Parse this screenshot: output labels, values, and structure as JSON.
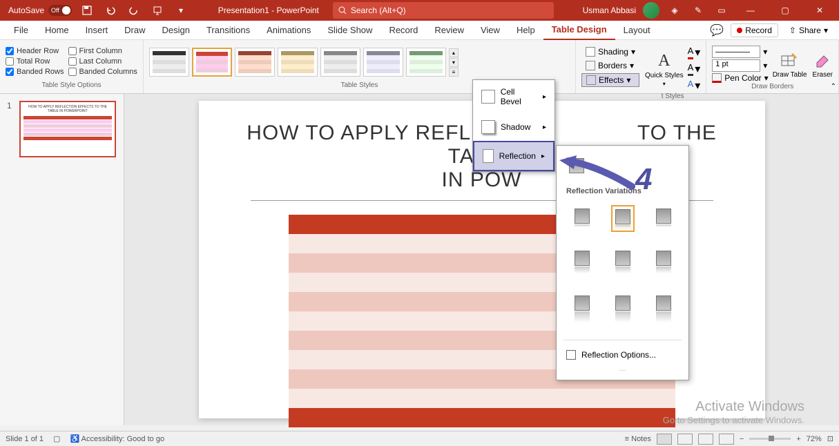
{
  "titlebar": {
    "autosave_label": "AutoSave",
    "autosave_state": "Off",
    "doc_title": "Presentation1 - PowerPoint",
    "search_placeholder": "Search (Alt+Q)",
    "user_name": "Usman Abbasi"
  },
  "tabs": {
    "file": "File",
    "home": "Home",
    "insert": "Insert",
    "draw": "Draw",
    "design": "Design",
    "transitions": "Transitions",
    "animations": "Animations",
    "slideshow": "Slide Show",
    "record": "Record",
    "review": "Review",
    "view": "View",
    "help": "Help",
    "table_design": "Table Design",
    "layout": "Layout",
    "record_btn": "Record",
    "share_btn": "Share"
  },
  "ribbon": {
    "style_options": {
      "header_row": "Header Row",
      "total_row": "Total Row",
      "banded_rows": "Banded Rows",
      "first_column": "First Column",
      "last_column": "Last Column",
      "banded_columns": "Banded Columns",
      "group_label": "Table Style Options"
    },
    "table_styles_label": "Table Styles",
    "shading": "Shading",
    "borders": "Borders",
    "effects": "Effects",
    "quick_styles": "Quick Styles",
    "wordart_label": "t Styles",
    "pen_weight": "1 pt",
    "pen_color": "Pen Color",
    "draw_table": "Draw Table",
    "eraser": "Eraser",
    "draw_borders_label": "Draw Borders"
  },
  "effects_menu": {
    "cell_bevel": "Cell Bevel",
    "shadow": "Shadow",
    "reflection": "Reflection"
  },
  "reflection_panel": {
    "variations_label": "Reflection Variations",
    "options_label": "Reflection Options..."
  },
  "annotation": {
    "number": "4"
  },
  "slide": {
    "title_line1": "HOW TO APPLY REFLECTION",
    "title_line2": "TO THE TABLE",
    "title_line3": "IN POW",
    "full_title": "HOW TO APPLY REFLECTION EFFECTS TO THE TABLE IN POWERPOINT"
  },
  "activate": {
    "title": "Activate Windows",
    "subtitle": "Go to Settings to activate Windows."
  },
  "statusbar": {
    "slide_info": "Slide 1 of 1",
    "accessibility": "Accessibility: Good to go",
    "notes": "Notes",
    "zoom": "72%"
  }
}
